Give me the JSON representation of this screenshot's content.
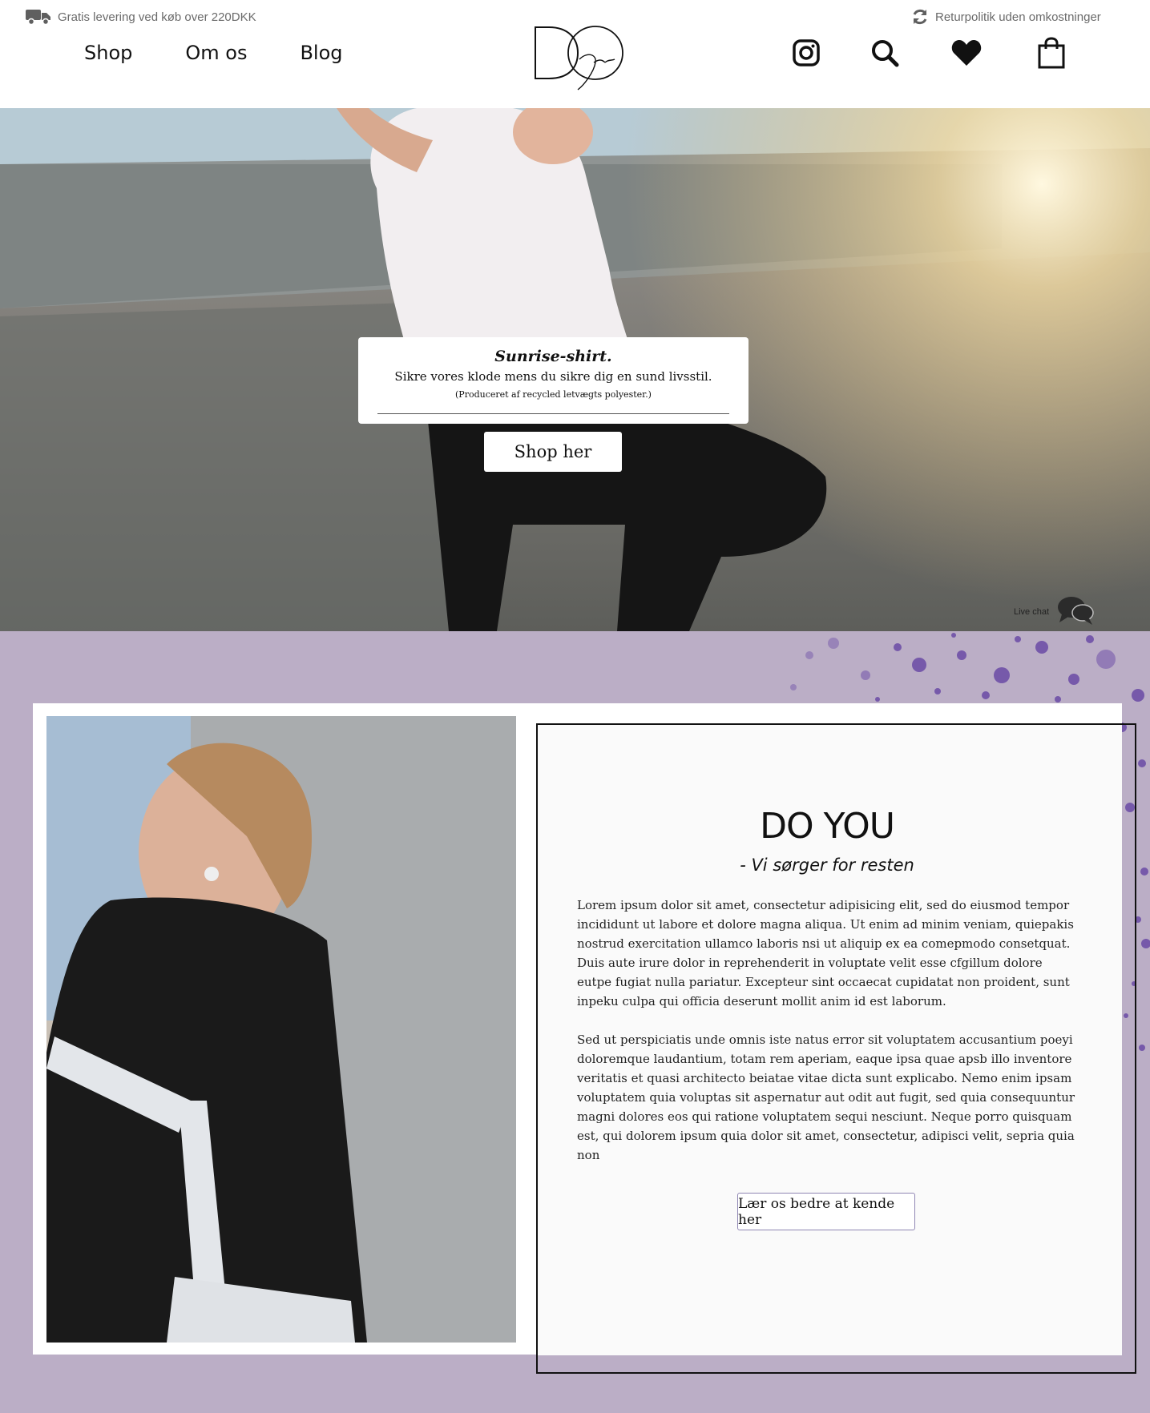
{
  "header": {
    "promo_left": "Gratis levering ved køb over 220DKK",
    "promo_right": "Returpolitik uden omkostninger",
    "nav": [
      {
        "label": "Shop"
      },
      {
        "label": "Om os"
      },
      {
        "label": "Blog"
      }
    ],
    "logo": {
      "main": "DO",
      "script": "You"
    },
    "icons": [
      "instagram-icon",
      "search-icon",
      "heart-icon",
      "shopping-bag-icon"
    ]
  },
  "hero": {
    "title": "Sunrise-shirt.",
    "subtitle": "Sikre vores klode mens du sikre dig en sund livsstil.",
    "note": "(Produceret af recycled letvægts polyester.)",
    "cta": "Shop her",
    "chat_label": "Live chat"
  },
  "about": {
    "title": "DO YOU",
    "subtitle": "- Vi sørger for resten",
    "paragraph1": "Lorem ipsum dolor sit amet, consectetur adipisicing elit, sed do eiusmod tempor incididunt ut labore et dolore magna aliqua. Ut enim ad minim veniam, quiepakis nostrud exercitation ullamco laboris nsi ut aliquip ex ea comepmodo consetquat. Duis aute irure dolor in reprehenderit in voluptate velit esse cfgillum dolore eutpe fugiat nulla pariatur. Excepteur sint occaecat cupidatat non proident, sunt inpeku culpa qui officia deserunt mollit anim id est laborum.",
    "paragraph2": "Sed ut perspiciatis unde omnis iste natus error sit voluptatem accusantium poeyi doloremque laudantium, totam rem aperiam, eaque ipsa quae apsb illo inventore veritatis et quasi architecto beiatae vitae dicta sunt explicabo. Nemo enim ipsam voluptatem quia voluptas sit aspernatur aut odit aut fugit, sed quia consequuntur magni dolores eos qui ratione voluptatem sequi nesciunt. Neque porro quisquam est, qui dolorem ipsum quia dolor sit amet, consectetur, adipisci velit, sepria quia non",
    "cta": "Lær os bedre at kende her"
  },
  "colors": {
    "section_background": "#bbaec6",
    "splatter": "#6a4aa6",
    "button_border": "#8f86b3"
  }
}
